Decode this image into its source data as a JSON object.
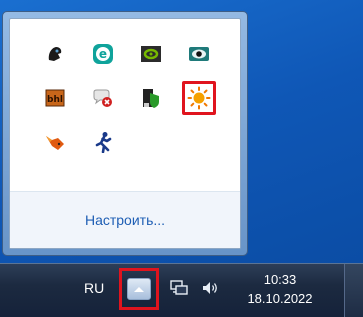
{
  "tray_popup": {
    "icons": [
      {
        "name": "app-dark-silhouette-icon",
        "color": "#1a1a1a"
      },
      {
        "name": "eset-icon",
        "color": "#0fa39b"
      },
      {
        "name": "nvidia-icon",
        "color": "#76b900"
      },
      {
        "name": "eye-icon",
        "color": "#1f7a7a"
      },
      {
        "name": "bhl-icon",
        "color": "#c8661a",
        "text": "bhl"
      },
      {
        "name": "chat-error-icon",
        "color": "#d02020"
      },
      {
        "name": "green-shield-icon",
        "color": "#2a9a2a"
      },
      {
        "name": "sun-icon",
        "color": "#f5a000",
        "highlighted": true
      },
      {
        "name": "fox-icon",
        "color": "#e05a10"
      },
      {
        "name": "running-man-icon",
        "color": "#1a3a8a"
      }
    ],
    "customize_label": "Настроить..."
  },
  "taskbar": {
    "language": "RU",
    "time": "10:33",
    "date": "18.10.2022",
    "highlight_color": "#e0141e"
  }
}
